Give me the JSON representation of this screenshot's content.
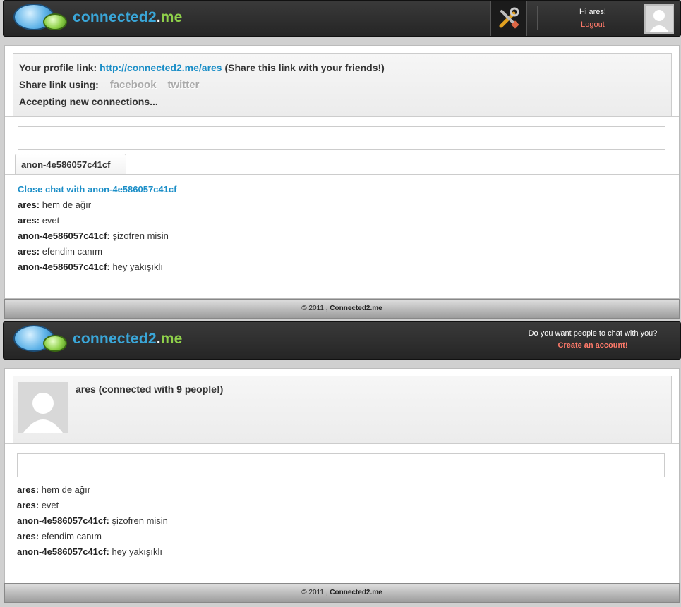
{
  "top": {
    "brand": {
      "name": "connected2",
      "dot": ".",
      "tld": "me"
    },
    "user": {
      "greeting_prefix": "Hi",
      "username": "ares",
      "greeting_suffix": "!",
      "logout": "Logout"
    },
    "info": {
      "profile_link_label": "Your profile link:",
      "profile_link_url": "http://connected2.me/ares",
      "profile_link_note": "(Share this link with your friends!)",
      "share_label": "Share link using:",
      "share_facebook": "facebook",
      "share_twitter": "twitter",
      "status": "Accepting new connections..."
    },
    "chat": {
      "input_value": "",
      "tab_label": "anon-4e586057c41cf",
      "close_link": "Close chat with anon-4e586057c41cf",
      "messages": [
        {
          "sender": "ares:",
          "text": "hem de ağır"
        },
        {
          "sender": "ares:",
          "text": "evet"
        },
        {
          "sender": "anon-4e586057c41cf:",
          "text": "şizofren misin"
        },
        {
          "sender": "ares:",
          "text": "efendim canım"
        },
        {
          "sender": "anon-4e586057c41cf:",
          "text": "hey yakışıklı"
        }
      ]
    },
    "footer": {
      "copyright": "© 2011 ,",
      "brand": "Connected2.me"
    }
  },
  "bottom": {
    "brand": {
      "name": "connected2",
      "dot": ".",
      "tld": "me"
    },
    "promo": {
      "question": "Do you want people to chat with you?",
      "cta": "Create an account!"
    },
    "profile": {
      "title": "ares (connected with 9 people!)"
    },
    "chat": {
      "input_value": "",
      "messages": [
        {
          "sender": "ares:",
          "text": "hem de ağır"
        },
        {
          "sender": "ares:",
          "text": "evet"
        },
        {
          "sender": "anon-4e586057c41cf:",
          "text": "şizofren misin"
        },
        {
          "sender": "ares:",
          "text": "efendim canım"
        },
        {
          "sender": "anon-4e586057c41cf:",
          "text": "hey yakışıklı"
        }
      ]
    },
    "footer": {
      "copyright": "© 2011 ,",
      "brand": "Connected2.me"
    }
  },
  "icons": {
    "tools": "tools-icon",
    "avatar": "avatar-placeholder-icon",
    "logo": "chat-bubbles-logo-icon"
  },
  "colors": {
    "link": "#1b8ec7",
    "logout": "#ff7a6a",
    "brand_blue": "#3aa6d8",
    "brand_green": "#8fd14a",
    "header_bg": "#2e2e2e"
  }
}
